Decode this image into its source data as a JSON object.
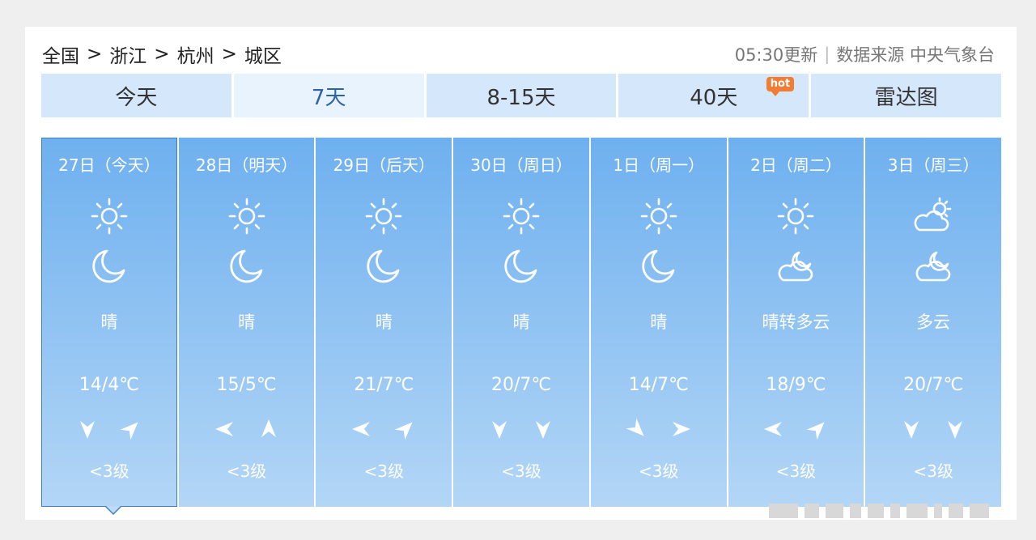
{
  "breadcrumb": {
    "items": [
      "全国",
      "浙江",
      "杭州",
      "城区"
    ],
    "separator": ">"
  },
  "meta": {
    "update_time": "05:30更新",
    "source": "数据来源 中央气象台"
  },
  "tabs": [
    {
      "label": "今天",
      "active": false
    },
    {
      "label": "7天",
      "active": true
    },
    {
      "label": "8-15天",
      "active": false
    },
    {
      "label": "40天",
      "active": false,
      "badge": "hot"
    },
    {
      "label": "雷达图",
      "active": false
    }
  ],
  "days": [
    {
      "date": "27日（今天）",
      "day_icon": "sun-icon",
      "night_icon": "moon-icon",
      "weather": "晴",
      "temp": "14/4℃",
      "wind_icons": [
        "wind-arrow-down-icon",
        "wind-arrow-up-right-icon"
      ],
      "level": "<3级"
    },
    {
      "date": "28日（明天）",
      "day_icon": "sun-icon",
      "night_icon": "moon-icon",
      "weather": "晴",
      "temp": "15/5℃",
      "wind_icons": [
        "wind-arrow-left-icon",
        "wind-arrow-up-icon"
      ],
      "level": "<3级"
    },
    {
      "date": "29日（后天）",
      "day_icon": "sun-icon",
      "night_icon": "moon-icon",
      "weather": "晴",
      "temp": "21/7℃",
      "wind_icons": [
        "wind-arrow-left-icon",
        "wind-arrow-up-right-icon"
      ],
      "level": "<3级"
    },
    {
      "date": "30日（周日）",
      "day_icon": "sun-icon",
      "night_icon": "moon-icon",
      "weather": "晴",
      "temp": "20/7℃",
      "wind_icons": [
        "wind-arrow-down-icon",
        "wind-arrow-down-icon"
      ],
      "level": "<3级"
    },
    {
      "date": "1日（周一）",
      "day_icon": "sun-icon",
      "night_icon": "moon-icon",
      "weather": "晴",
      "temp": "14/7℃",
      "wind_icons": [
        "wind-arrow-down-right-icon",
        "wind-arrow-right-icon"
      ],
      "level": "<3级"
    },
    {
      "date": "2日（周二）",
      "day_icon": "sun-icon",
      "night_icon": "cloudy-night-icon",
      "weather": "晴转多云",
      "temp": "18/9℃",
      "wind_icons": [
        "wind-arrow-left-icon",
        "wind-arrow-up-right-icon"
      ],
      "level": "<3级"
    },
    {
      "date": "3日（周三）",
      "day_icon": "partly-cloudy-icon",
      "night_icon": "cloudy-night-icon",
      "weather": "多云",
      "temp": "20/7℃",
      "wind_icons": [
        "wind-arrow-down-icon",
        "wind-arrow-down-icon"
      ],
      "level": "<3级"
    }
  ],
  "selected_day": 0,
  "colors": {
    "card_top": "#6eb0ef",
    "card_bottom": "#b3d6f6",
    "tab_bg": "#d5e7fa",
    "active_tab_text": "#2d63a8",
    "hot_badge": "#f07d33"
  }
}
